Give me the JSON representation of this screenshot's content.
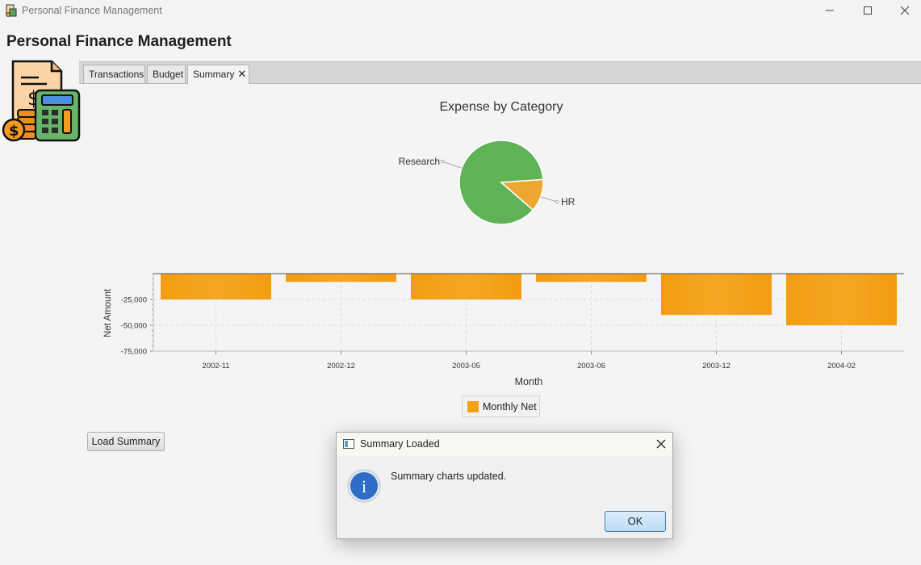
{
  "window": {
    "title": "Personal Finance Management",
    "icon": "ledger-calculator-icon",
    "controls": [
      "minimize-icon",
      "maximize-icon",
      "close-icon"
    ]
  },
  "app": {
    "heading": "Personal Finance Management",
    "logo_icon": "invoice-calculator-coins-icon"
  },
  "tabs": [
    {
      "label": "Transactions",
      "active": false
    },
    {
      "label": "Budget",
      "active": false
    },
    {
      "label": "Summary",
      "active": true,
      "close_glyph": "✕"
    }
  ],
  "colors": {
    "pie_research": "#5fb356",
    "pie_hr": "#eda630",
    "bar": "#f4a11a",
    "ok_button": "#c6e2f8",
    "info_icon": "#2f6cc6"
  },
  "chart_data": [
    {
      "type": "pie",
      "title": "Expense by Category",
      "slices": [
        {
          "label": "Research",
          "value": 87.5
        },
        {
          "label": "HR",
          "value": 12.5
        }
      ]
    },
    {
      "type": "bar",
      "categories": [
        "2002-11",
        "2002-12",
        "2003-05",
        "2003-06",
        "2003-12",
        "2004-02"
      ],
      "series": [
        {
          "name": "Monthly Net",
          "values": [
            -25000,
            -8000,
            -25000,
            -8000,
            -40000,
            -50000
          ]
        }
      ],
      "xlabel": "Month",
      "ylabel": "Net Amount",
      "yticks": [
        -25000,
        -50000,
        -75000
      ],
      "ytick_labels": [
        "-25,000",
        "-50,000",
        "-75,000"
      ],
      "ylim": [
        -75000,
        0
      ],
      "grid": true,
      "legend": "bottom-center"
    }
  ],
  "summary_button": {
    "label": "Load Summary"
  },
  "dialog": {
    "title": "Summary Loaded",
    "message": "Summary charts updated.",
    "ok_label": "OK",
    "icon": "info-icon",
    "info_glyph": "i"
  }
}
